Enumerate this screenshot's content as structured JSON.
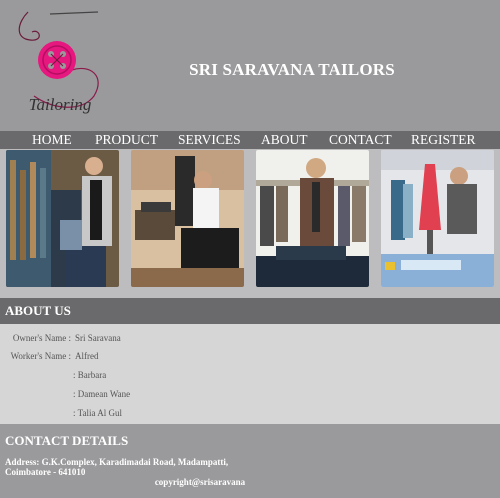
{
  "header": {
    "site_title": "SRI SARAVANA TAILORS",
    "logo_text": "Tailoring",
    "brand_color": "#e6177f",
    "background": "#9a9a9c"
  },
  "nav": {
    "items": [
      {
        "label": "HOME"
      },
      {
        "label": "PRODUCT"
      },
      {
        "label": "SERVICES"
      },
      {
        "label": "ABOUT"
      },
      {
        "label": "CONTACT"
      },
      {
        "label": "REGISTER"
      }
    ]
  },
  "gallery": {
    "images": [
      {
        "subject": "tailor-measuring-client-photo"
      },
      {
        "subject": "woman-sewing-machine-photo"
      },
      {
        "subject": "man-tailor-cutting-fabric-photo"
      },
      {
        "subject": "woman-designer-studio-photo"
      }
    ]
  },
  "about": {
    "title": "ABOUT US",
    "owner_label": "Owner's Name :",
    "owner_value": "Sri Saravana",
    "worker_label": "Worker's Name :",
    "workers": [
      "Alfred",
      ": Barbara",
      ": Damean Wane",
      ": Talia Al Gul"
    ]
  },
  "contact": {
    "title": "CONTACT DETAILS",
    "address_line1": "Address: G.K.Complex, Karadimadai Road, Madampatti,",
    "address_line2": "Coimbatore - 641010",
    "copyright": "copyright@srisaravana"
  }
}
